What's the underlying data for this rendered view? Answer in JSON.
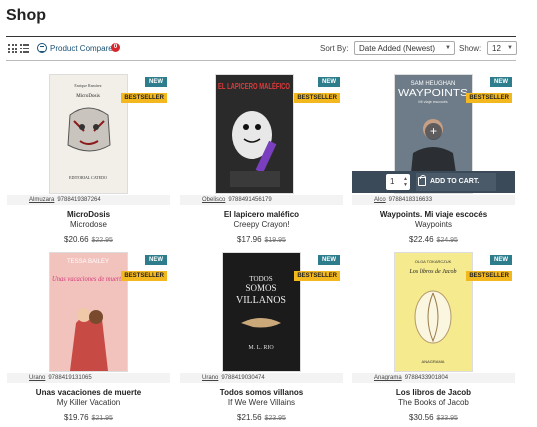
{
  "page": {
    "title": "Shop"
  },
  "toolbar": {
    "compare_label": "Product Compare",
    "compare_count": "0",
    "sort_label": "Sort By:",
    "sort_value": "Date Added (Newest)",
    "show_label": "Show:",
    "show_value": "12"
  },
  "badges": {
    "new": "NEW",
    "bestseller": "BESTSELLER"
  },
  "add_to_cart": {
    "qty": "1",
    "label": "ADD TO CART."
  },
  "products": [
    {
      "publisher": "Almuzara",
      "isbn": "9788419387264",
      "name": "MicroDosis",
      "subtitle": "Microdose",
      "price": "$20.66",
      "old_price": "$22.95",
      "cover": {
        "author": "Enrique Ramírez",
        "title": "MicroDosis",
        "publisher": "EDITORIAL CATEDO"
      }
    },
    {
      "publisher": "Obelisco",
      "isbn": "9788491456179",
      "name": "El lapicero maléfico",
      "subtitle": "Creepy Crayon!",
      "price": "$17.96",
      "old_price": "$19.95",
      "cover": {
        "title": "EL LAPICERO MALÉFICO"
      }
    },
    {
      "publisher": "Alco",
      "isbn": "9788418316633",
      "name": "Waypoints. Mi viaje escocés",
      "subtitle": "Waypoints",
      "price": "$22.46",
      "old_price": "$24.95",
      "cover": {
        "author": "SAM HEUGHAN",
        "title": "WAYPOINTS",
        "tagline": "Mi viaje escocés"
      }
    },
    {
      "publisher": "Urano",
      "isbn": "9788419131065",
      "name": "Unas vacaciones de muerte",
      "subtitle": "My Killer Vacation",
      "price": "$19.76",
      "old_price": "$21.95",
      "cover": {
        "author": "TESSA BAILEY",
        "title": "Unas vacaciones de muerte"
      }
    },
    {
      "publisher": "Urano",
      "isbn": "9788419030474",
      "name": "Todos somos villanos",
      "subtitle": "If We Were Villains",
      "price": "$21.56",
      "old_price": "$23.95",
      "cover": {
        "title_l1": "TODOS",
        "title_l2": "SOMOS",
        "title_l3": "VILLANOS",
        "author": "M. L. RIO"
      }
    },
    {
      "publisher": "Anagrama",
      "isbn": "9788433901804",
      "name": "Los libros de Jacob",
      "subtitle": "The Books of Jacob",
      "price": "$30.56",
      "old_price": "$33.95",
      "cover": {
        "author": "OLGA TOKARCZUK",
        "title": "Los libros de Jacob",
        "publisher": "ANAGRAMA"
      }
    }
  ]
}
